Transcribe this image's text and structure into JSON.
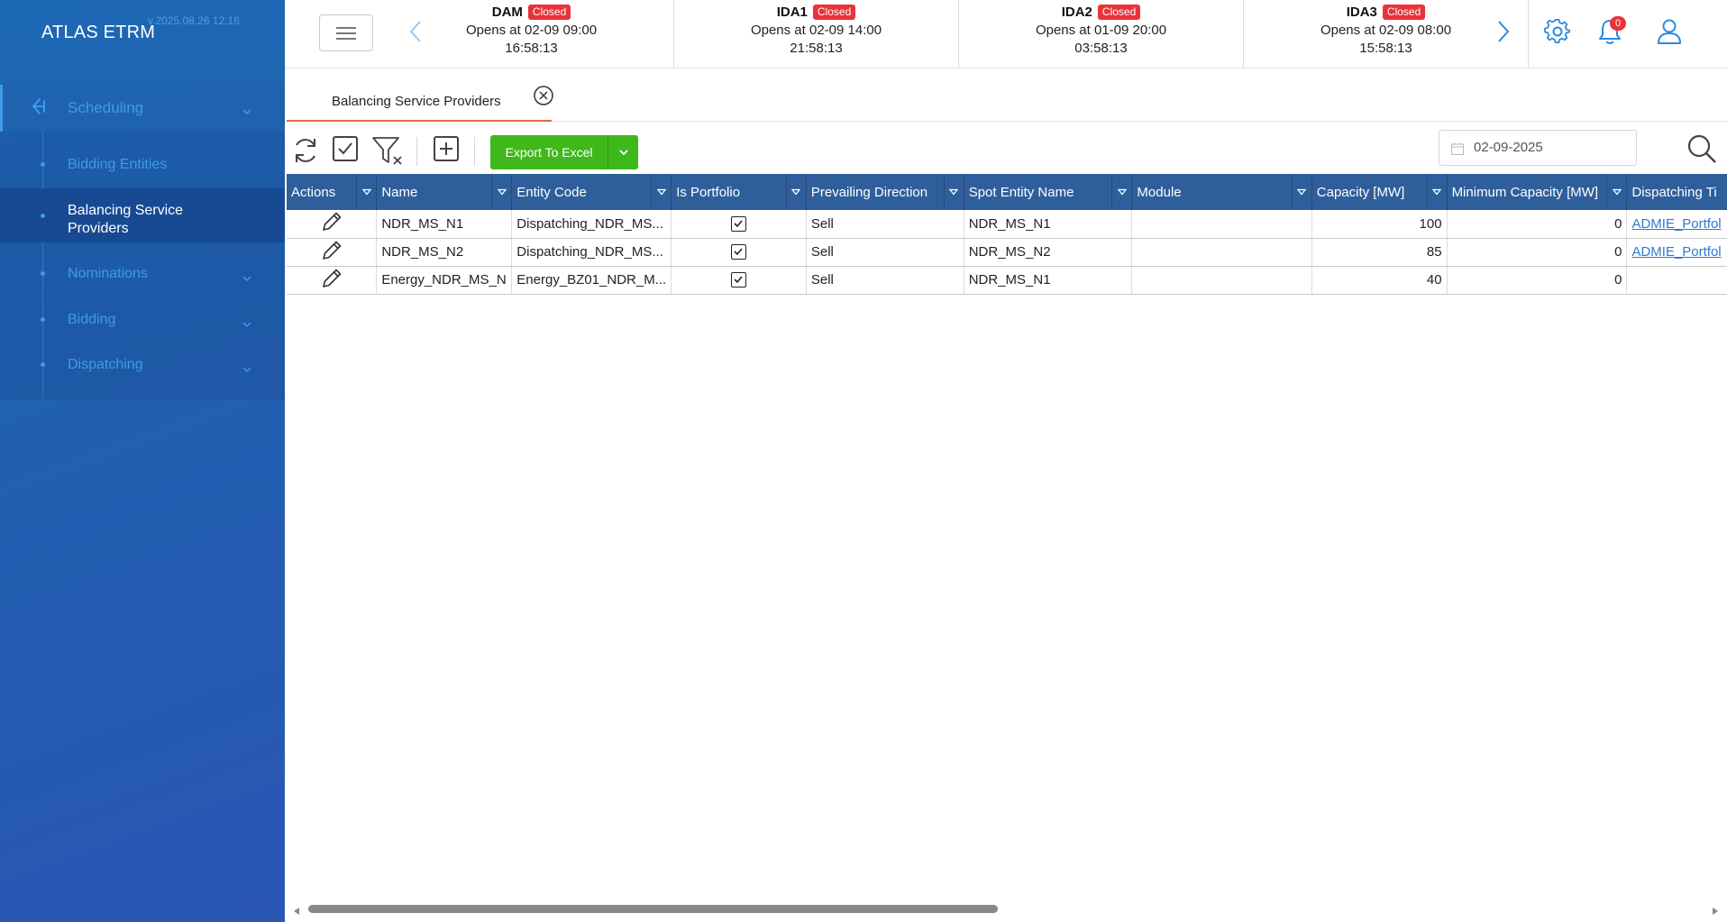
{
  "app": {
    "title": "ATLAS ETRM",
    "version": "v.2025.08.26 12:16"
  },
  "sidebar": {
    "section": "Scheduling",
    "items": [
      {
        "label": "Bidding Entities"
      },
      {
        "label": "Balancing Service Providers"
      },
      {
        "label": "Nominations"
      },
      {
        "label": "Bidding"
      },
      {
        "label": "Dispatching"
      }
    ]
  },
  "markets": [
    {
      "name": "DAM",
      "status": "Closed",
      "opens": "Opens at 02-09 09:00",
      "timer": "16:58:13"
    },
    {
      "name": "IDA1",
      "status": "Closed",
      "opens": "Opens at 02-09 14:00",
      "timer": "21:58:13"
    },
    {
      "name": "IDA2",
      "status": "Closed",
      "opens": "Opens at 01-09 20:00",
      "timer": "03:58:13"
    },
    {
      "name": "IDA3",
      "status": "Closed",
      "opens": "Opens at 02-09 08:00",
      "timer": "15:58:13"
    }
  ],
  "notifications": {
    "count": "0"
  },
  "tab": {
    "label": "Balancing Service Providers"
  },
  "toolbar": {
    "export_label": "Export To Excel",
    "date": "02-09-2025"
  },
  "grid": {
    "columns": [
      "Actions",
      "Name",
      "Entity Code",
      "Is Portfolio",
      "Prevailing Direction",
      "Spot Entity Name",
      "Module",
      "Capacity [MW]",
      "Minimum Capacity [MW]",
      "Dispatching Ti"
    ],
    "rows": [
      {
        "name": "NDR_MS_N1",
        "entity_code": "Dispatching_NDR_MS...",
        "is_portfolio": true,
        "direction": "Sell",
        "spot": "NDR_MS_N1",
        "module": "",
        "capacity": "100",
        "min_capacity": "0",
        "dispatching": "ADMIE_Portfol"
      },
      {
        "name": "NDR_MS_N2",
        "entity_code": "Dispatching_NDR_MS...",
        "is_portfolio": true,
        "direction": "Sell",
        "spot": "NDR_MS_N2",
        "module": "",
        "capacity": "85",
        "min_capacity": "0",
        "dispatching": "ADMIE_Portfol"
      },
      {
        "name": "Energy_NDR_MS_N",
        "entity_code": "Energy_BZ01_NDR_M...",
        "is_portfolio": true,
        "direction": "Sell",
        "spot": "NDR_MS_N1",
        "module": "",
        "capacity": "40",
        "min_capacity": "0",
        "dispatching": ""
      }
    ]
  },
  "colors": {
    "sidebar": "#1f63b0",
    "accent": "#3d9be9",
    "header": "#2f5f9b",
    "export": "#3fb81b",
    "badge": "#e8333a",
    "tab_underline": "#e0684b"
  }
}
